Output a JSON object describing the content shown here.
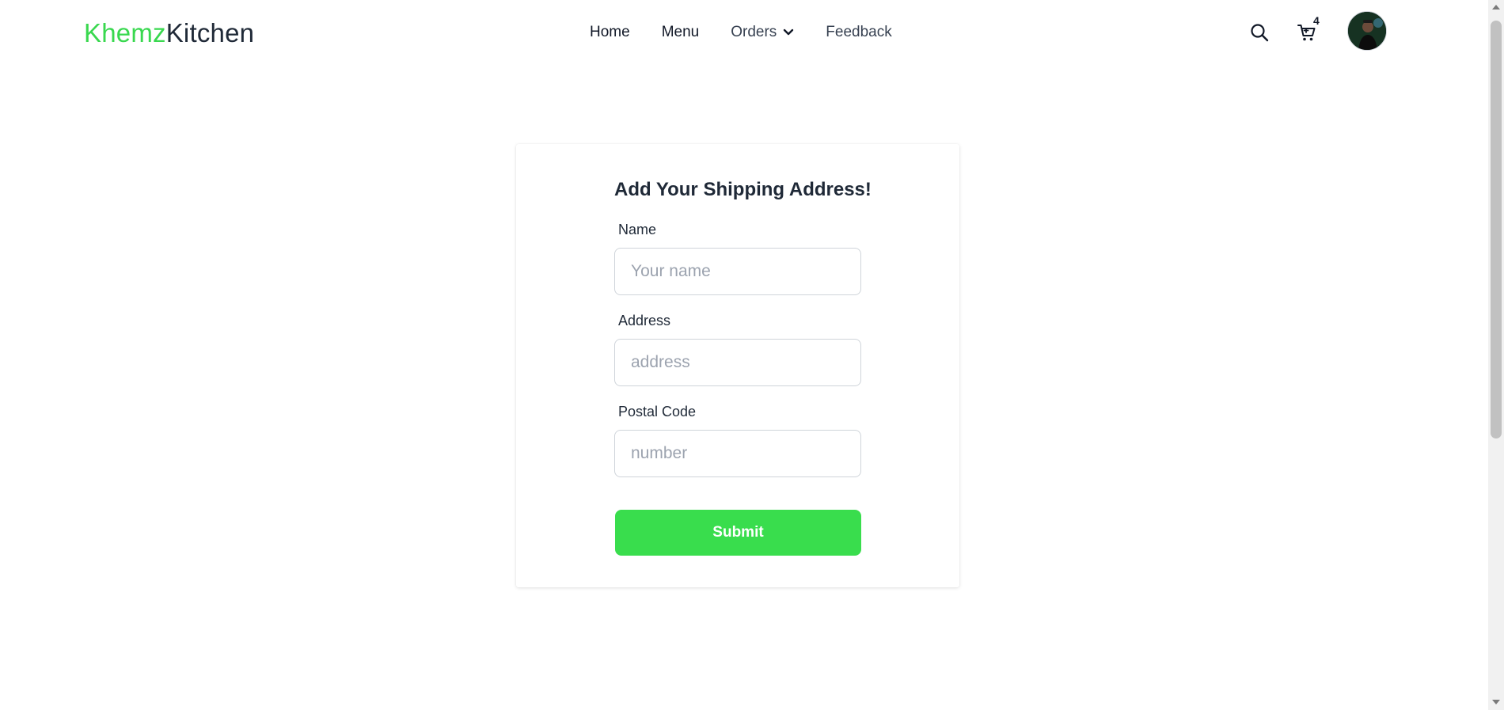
{
  "brand": {
    "part1": "Khemz",
    "part2": "Kitchen",
    "accent_color": "#39d84f"
  },
  "nav": {
    "items": [
      {
        "label": "Home"
      },
      {
        "label": "Menu"
      },
      {
        "label": "Orders",
        "has_dropdown": true
      },
      {
        "label": "Feedback"
      }
    ]
  },
  "header_icons": {
    "search": "search-icon",
    "cart": "cart-icon",
    "cart_count": "4",
    "avatar": "user-avatar"
  },
  "form": {
    "title": "Add Your Shipping Address!",
    "fields": [
      {
        "label": "Name",
        "placeholder": "Your name",
        "value": ""
      },
      {
        "label": "Address",
        "placeholder": "address",
        "value": ""
      },
      {
        "label": "Postal Code",
        "placeholder": "number",
        "value": ""
      }
    ],
    "submit_label": "Submit",
    "submit_color": "#39dd4d"
  }
}
